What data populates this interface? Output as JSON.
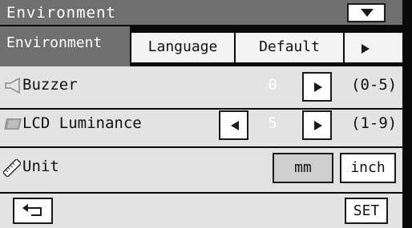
{
  "window": {
    "title": "Environment"
  },
  "tabs": [
    {
      "label": "Environment",
      "active": true
    },
    {
      "label": "Language"
    },
    {
      "label": "Default"
    }
  ],
  "settings": {
    "buzzer": {
      "label": "Buzzer",
      "value": "0",
      "range": "(0-5)"
    },
    "lcd": {
      "label": "LCD Luminance",
      "value": "5",
      "range": "(1-9)"
    },
    "unit": {
      "label": "Unit",
      "options": [
        "mm",
        "inch"
      ],
      "selected": "mm"
    }
  },
  "footer": {
    "set_label": "SET"
  },
  "icons": {
    "dropdown": "triangle-down-icon",
    "tab_next": "triangle-right-icon",
    "buzzer": "speaker-icon",
    "lcd": "lcd-panel-icon",
    "unit": "ruler-icon",
    "back": "return-arrow-icon"
  },
  "colors": {
    "header_bg": "#6f6f6f",
    "panel_bg": "#e3e3e3",
    "selected_option_bg": "#cfcfcf"
  }
}
